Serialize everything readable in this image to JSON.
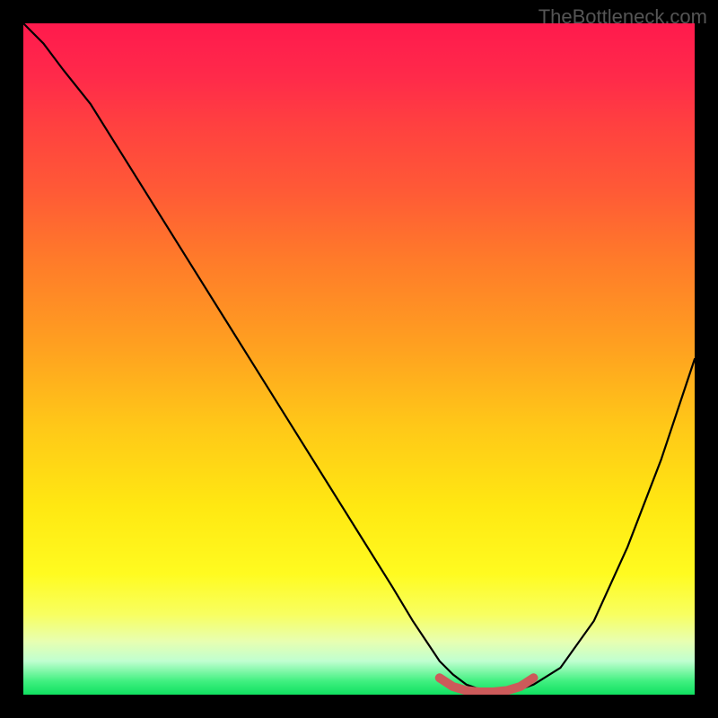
{
  "watermark": "TheBottleneck.com",
  "chart_data": {
    "type": "line",
    "title": "",
    "xlabel": "",
    "ylabel": "",
    "xlim": [
      0,
      100
    ],
    "ylim": [
      0,
      100
    ],
    "grid": false,
    "legend": false,
    "series": [
      {
        "name": "bottleneck-curve",
        "color": "#000000",
        "x": [
          0,
          3,
          6,
          10,
          15,
          20,
          25,
          30,
          35,
          40,
          45,
          50,
          55,
          58,
          60,
          62,
          64,
          66,
          68,
          70,
          72,
          74,
          76,
          80,
          85,
          90,
          95,
          100
        ],
        "y": [
          100,
          97,
          93,
          88,
          80,
          72,
          64,
          56,
          48,
          40,
          32,
          24,
          16,
          11,
          8,
          5,
          3,
          1.5,
          0.8,
          0.5,
          0.5,
          0.8,
          1.5,
          4,
          11,
          22,
          35,
          50
        ]
      },
      {
        "name": "optimal-zone-marker",
        "color": "#d15a5a",
        "x": [
          62,
          64,
          66,
          68,
          70,
          72,
          74,
          76
        ],
        "y": [
          2.5,
          1.2,
          0.6,
          0.4,
          0.4,
          0.6,
          1.2,
          2.5
        ]
      }
    ],
    "background_gradient": {
      "top": "#ff1a4d",
      "mid": "#ffe812",
      "bottom": "#10e060"
    }
  }
}
